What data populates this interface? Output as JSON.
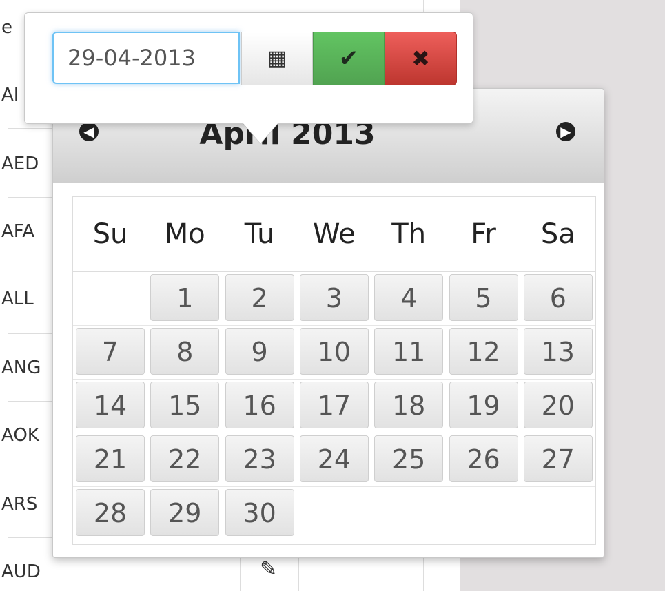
{
  "table": {
    "codes": [
      "AED",
      "AFA",
      "ALL",
      "ANG",
      "AOK",
      "ARS",
      "AUD"
    ],
    "partial_codes": [
      "e",
      "AI"
    ]
  },
  "editor": {
    "date_value": "29-04-2013",
    "calendar_button_icon": "calendar-icon",
    "confirm_button_icon": "check-icon",
    "cancel_button_icon": "close-icon"
  },
  "datepicker": {
    "month_title": "April 2013",
    "prev_icon": "arrow-left-icon",
    "next_icon": "arrow-right-icon",
    "weekdays": [
      "Su",
      "Mo",
      "Tu",
      "We",
      "Th",
      "Fr",
      "Sa"
    ],
    "days": [
      "1",
      "2",
      "3",
      "4",
      "5",
      "6",
      "7",
      "8",
      "9",
      "10",
      "11",
      "12",
      "13",
      "14",
      "15",
      "16",
      "17",
      "18",
      "19",
      "20",
      "21",
      "22",
      "23",
      "24",
      "25",
      "26",
      "27",
      "28",
      "29",
      "30"
    ],
    "first_weekday_index": 1
  },
  "colors": {
    "input_focus": "#6ec3f5",
    "confirm": "#5bb75b",
    "cancel": "#da4f49"
  }
}
